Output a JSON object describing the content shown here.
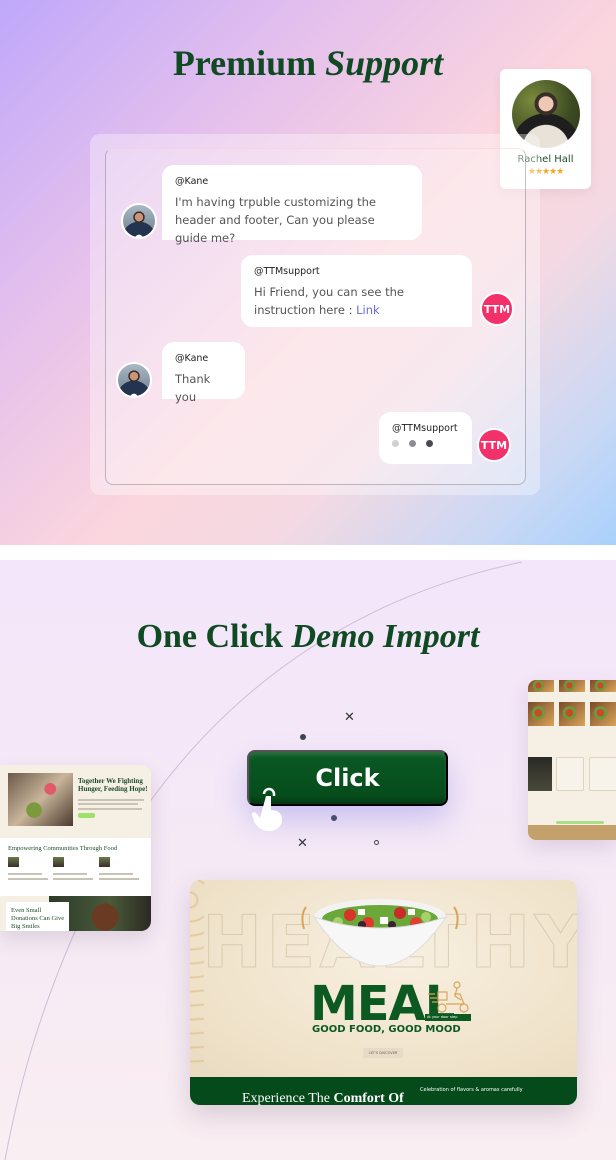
{
  "premium_support": {
    "title_plain": "Premium",
    "title_italic": "Support",
    "colors": {
      "title": "#0f4a22",
      "ttm_avatar": "#f2306a",
      "link": "#6b6ad6",
      "stars": "#f5a623"
    },
    "agent_card": {
      "name": "Rachel Hall",
      "rating": 5,
      "stars": "★★★★★"
    },
    "chat": [
      {
        "from": "user",
        "handle": "@Kane",
        "text": "I'm having trpuble customizing the header and footer, Can you please guide me?"
      },
      {
        "from": "support",
        "handle": "@TTMsupport",
        "text": "Hi Friend, you can see the instruction here : ",
        "link_text": "Link",
        "avatar_text": "TTM"
      },
      {
        "from": "user",
        "handle": "@Kane",
        "text": "Thank you"
      },
      {
        "from": "support",
        "handle": "@TTMsupport",
        "typing": true,
        "typing_dot_colors": [
          "#cfcfd4",
          "#8d8d95",
          "#4a4a55"
        ],
        "avatar_text": "TTM"
      }
    ]
  },
  "demo_import": {
    "title_plain": "One Click",
    "title_italic": "Demo Import",
    "button_label": "Click",
    "button_color": "#054a1a",
    "left_preview": {
      "hero_title": "Together We Fighting Hunger, Feeding Hope!",
      "section_title": "Empowering Communities Through Food",
      "cta_title": "Even Small Donations Can Give Big Smiles"
    },
    "main_preview": {
      "bg_word": "HEALTHY",
      "headline": "MEAL",
      "tag": "At your door step",
      "tagline": "GOOD FOOD, GOOD MOOD",
      "button_label": "LET'S DISCOVER",
      "footer_title_plain": "Experience The",
      "footer_title_bold": "Comfort Of",
      "footer_desc": "Celebration of flavors & aromas carefully"
    }
  }
}
